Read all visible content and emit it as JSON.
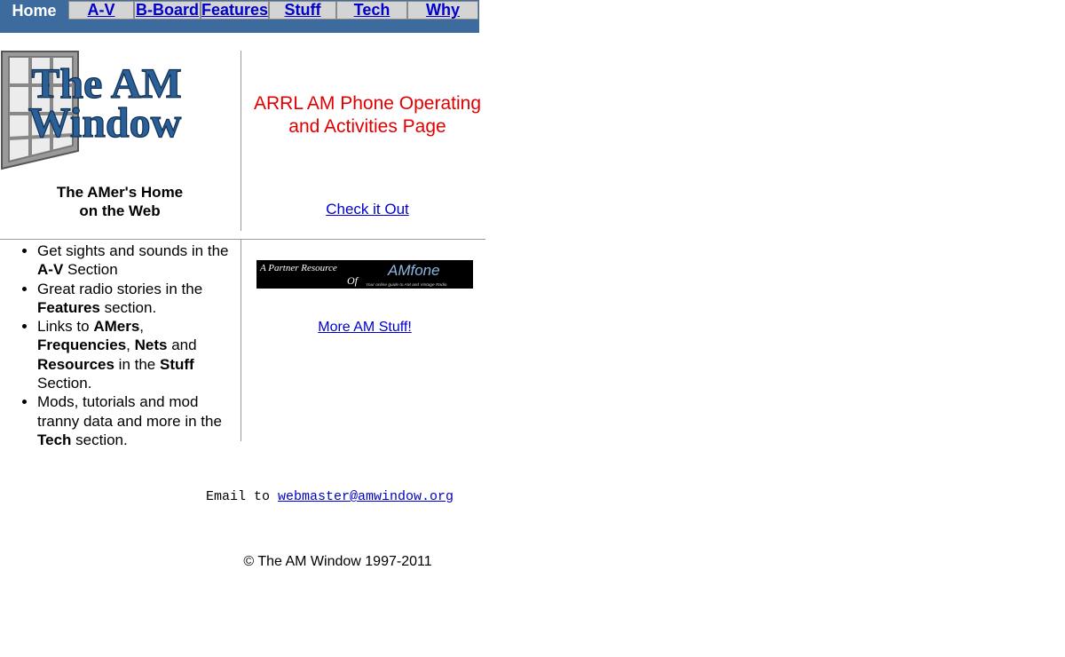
{
  "nav": {
    "home_label": "Home",
    "items": [
      {
        "label": "A-V"
      },
      {
        "label": "B-Board"
      },
      {
        "label": "Features"
      },
      {
        "label": "Stuff"
      },
      {
        "label": "Tech"
      },
      {
        "label": "Why"
      }
    ],
    "bar_color": "#3d6b9e",
    "link_color": "#0000cc"
  },
  "logo": {
    "line1": "The AM",
    "line2": "Window"
  },
  "tagline": {
    "line1": "The AMer's Home",
    "line2": "on the Web"
  },
  "arrl": {
    "title_line1": "ARRL AM Phone Operating",
    "title_line2": "and Activities Page",
    "link": "Check it Out",
    "title_color": "#e00000"
  },
  "features": [
    [
      {
        "t": "Get sights and sounds in the "
      },
      {
        "t": "A-V",
        "b": true
      },
      {
        "t": " Section"
      }
    ],
    [
      {
        "t": "Great radio stories in the "
      },
      {
        "t": "Features",
        "b": true
      },
      {
        "t": " section."
      }
    ],
    [
      {
        "t": "Links to "
      },
      {
        "t": "AMers",
        "b": true
      },
      {
        "t": ", "
      },
      {
        "t": "Frequencies",
        "b": true
      },
      {
        "t": ", "
      },
      {
        "t": "Nets",
        "b": true
      },
      {
        "t": " and "
      },
      {
        "t": "Resources",
        "b": true
      },
      {
        "t": " in the "
      },
      {
        "t": "Stuff",
        "b": true
      },
      {
        "t": " Section."
      }
    ],
    [
      {
        "t": "Mods, tutorials and mod tranny data and more in the "
      },
      {
        "t": "Tech",
        "b": true
      },
      {
        "t": " section."
      }
    ]
  ],
  "partner": {
    "prefix": "A Partner Resource",
    "of": "Of",
    "brand": "AMfone",
    "tagline": "Your online guide to AM and Vintage Radio"
  },
  "more_link": "More AM Stuff!",
  "email": {
    "prefix": "Email to ",
    "address": "webmaster@amwindow.org"
  },
  "copyright": "© The AM Window 1997-2011"
}
